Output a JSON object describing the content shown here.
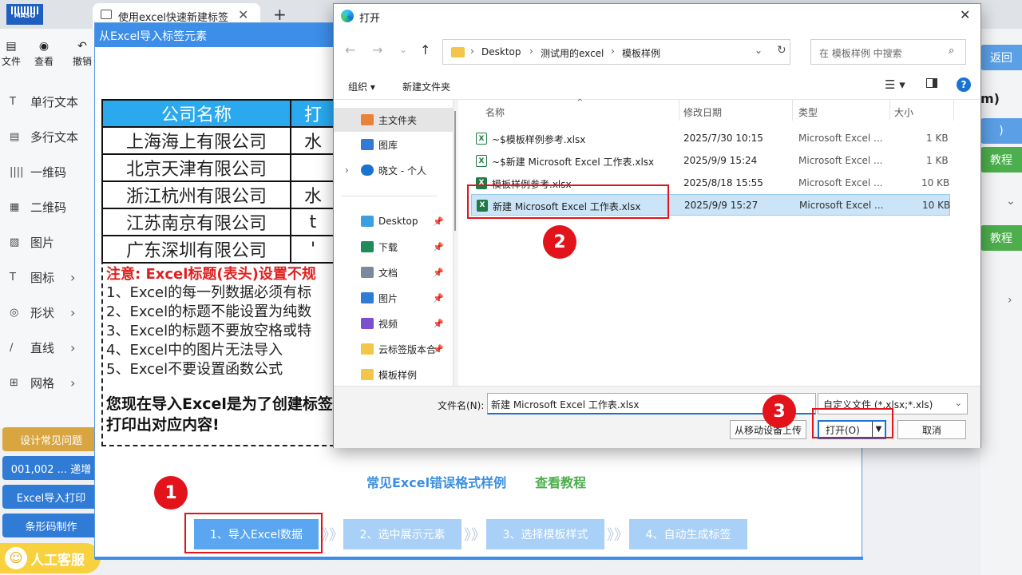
{
  "browser": {
    "logo_text": "MASO",
    "tab_title": "使用excel快速新建标签",
    "tab_close": "✕",
    "new_tab": "+"
  },
  "toolbar": {
    "items": [
      {
        "icon": "file-icon",
        "label": "文件"
      },
      {
        "icon": "eye-icon",
        "label": "查看"
      },
      {
        "icon": "undo-icon",
        "label": "撤销"
      }
    ]
  },
  "sidebar": {
    "items": [
      {
        "icon": "T",
        "label": "单行文本",
        "chevron": ""
      },
      {
        "icon": "▤",
        "label": "多行文本",
        "chevron": ""
      },
      {
        "icon": "||||",
        "label": "一维码",
        "chevron": ""
      },
      {
        "icon": "▦",
        "label": "二维码",
        "chevron": ""
      },
      {
        "icon": "▨",
        "label": "图片",
        "chevron": ""
      },
      {
        "icon": "T",
        "label": "图标",
        "chevron": "›"
      },
      {
        "icon": "◎",
        "label": "形状",
        "chevron": "›"
      },
      {
        "icon": "∕",
        "label": "直线",
        "chevron": "›"
      },
      {
        "icon": "⊞",
        "label": "网格",
        "chevron": "›"
      }
    ],
    "buttons": [
      {
        "label": "设计常见问题",
        "color": "#d9a540"
      },
      {
        "label": "001,002 ... 递增",
        "color": "#2f7bd6"
      },
      {
        "label": "Excel导入打印",
        "color": "#2f7bd6"
      },
      {
        "label": "条形码制作",
        "color": "#2f7bd6"
      }
    ],
    "customer_service": "人工客服"
  },
  "right_panel": {
    "back": "返回",
    "tutorial_1": "教程",
    "tutorial_2": "教程",
    "partial_m": "m)",
    "partial_paren": ")"
  },
  "import_modal": {
    "title": "从Excel导入标签元素",
    "table": {
      "headers": [
        "公司名称",
        "打"
      ],
      "rows": [
        [
          "上海海上有限公司",
          "水"
        ],
        [
          "北京天津有限公司",
          ""
        ],
        [
          "浙江杭州有限公司",
          "水"
        ],
        [
          "江苏南京有限公司",
          "t"
        ],
        [
          "广东深圳有限公司",
          "'"
        ]
      ]
    },
    "notes": {
      "title": "注意: Excel标题(表头)设置不规",
      "lines": [
        "1、Excel的每一列数据必须有标",
        "2、Excel的标题不能设置为纯数",
        "3、Excel的标题不要放空格或特",
        "4、Excel中的图片无法导入",
        "5、Excel不要设置函数公式"
      ],
      "footer_line1": "您现在导入Excel是为了创建标签",
      "footer_line2": "打印出对应内容!"
    },
    "error_samples_link": "常见Excel错误格式样例",
    "tutorial_link": "查看教程",
    "steps": [
      "1、导入Excel数据",
      "2、选中展示元素",
      "3、选择模板样式",
      "4、自动生成标签"
    ],
    "step_separator": "》》"
  },
  "open_dialog": {
    "title": "打开",
    "close": "✕",
    "breadcrumb": [
      "Desktop",
      "测试用的excel",
      "模板样例"
    ],
    "search_placeholder": "在 模板样例 中搜索",
    "organize": "组织 ▾",
    "new_folder": "新建文件夹",
    "nav_pane": [
      {
        "label": "主文件夹",
        "icon": "home-icon",
        "color": "#e8833a",
        "pinned": false,
        "expand": ""
      },
      {
        "label": "图库",
        "icon": "gallery-icon",
        "color": "#2f7bd6",
        "pinned": false,
        "expand": ""
      },
      {
        "label": "晓文 - 个人",
        "icon": "cloud-icon",
        "color": "#1b73d1",
        "pinned": false,
        "expand": "›"
      },
      {
        "label": "Desktop",
        "icon": "desktop-icon",
        "color": "#3aa0e0",
        "pinned": true,
        "expand": ""
      },
      {
        "label": "下载",
        "icon": "download-icon",
        "color": "#1f8a5a",
        "pinned": true,
        "expand": ""
      },
      {
        "label": "文档",
        "icon": "document-icon",
        "color": "#7a8a9a",
        "pinned": true,
        "expand": ""
      },
      {
        "label": "图片",
        "icon": "picture-icon",
        "color": "#2f7bd6",
        "pinned": true,
        "expand": ""
      },
      {
        "label": "视频",
        "icon": "video-icon",
        "color": "#7a4fd0",
        "pinned": true,
        "expand": ""
      },
      {
        "label": "云标签版本合",
        "icon": "folder-icon",
        "color": "#f3c649",
        "pinned": true,
        "expand": ""
      },
      {
        "label": "模板样例",
        "icon": "folder-icon",
        "color": "#f3c649",
        "pinned": false,
        "expand": ""
      }
    ],
    "columns": {
      "name": "名称",
      "modified": "修改日期",
      "type": "类型",
      "size": "大小"
    },
    "files": [
      {
        "name": "~$模板样例参考.xlsx",
        "modified": "2025/7/30 10:15",
        "type": "Microsoft Excel ...",
        "size": "1 KB",
        "selected": false,
        "ghost": true
      },
      {
        "name": "~$新建 Microsoft Excel 工作表.xlsx",
        "modified": "2025/9/9 15:24",
        "type": "Microsoft Excel ...",
        "size": "1 KB",
        "selected": false,
        "ghost": true
      },
      {
        "name": "模板样例参考.xlsx",
        "modified": "2025/8/18 15:55",
        "type": "Microsoft Excel ...",
        "size": "10 KB",
        "selected": false,
        "ghost": false
      },
      {
        "name": "新建 Microsoft Excel 工作表.xlsx",
        "modified": "2025/9/9 15:27",
        "type": "Microsoft Excel ...",
        "size": "10 KB",
        "selected": true,
        "ghost": false
      }
    ],
    "filename_label": "文件名(N):",
    "filename_value": "新建 Microsoft Excel 工作表.xlsx",
    "filter": "自定义文件 (*.xlsx;*.xls)",
    "upload_from_mobile": "从移动设备上传",
    "open_button": "打开(O)",
    "cancel_button": "取消"
  },
  "annotations": {
    "badge_1": "1",
    "badge_2": "2",
    "badge_3": "3"
  },
  "colors": {
    "accent_blue": "#3d8ee8",
    "red": "#e3131b",
    "table_header": "#2aa9ef",
    "green": "#4cae4c"
  }
}
